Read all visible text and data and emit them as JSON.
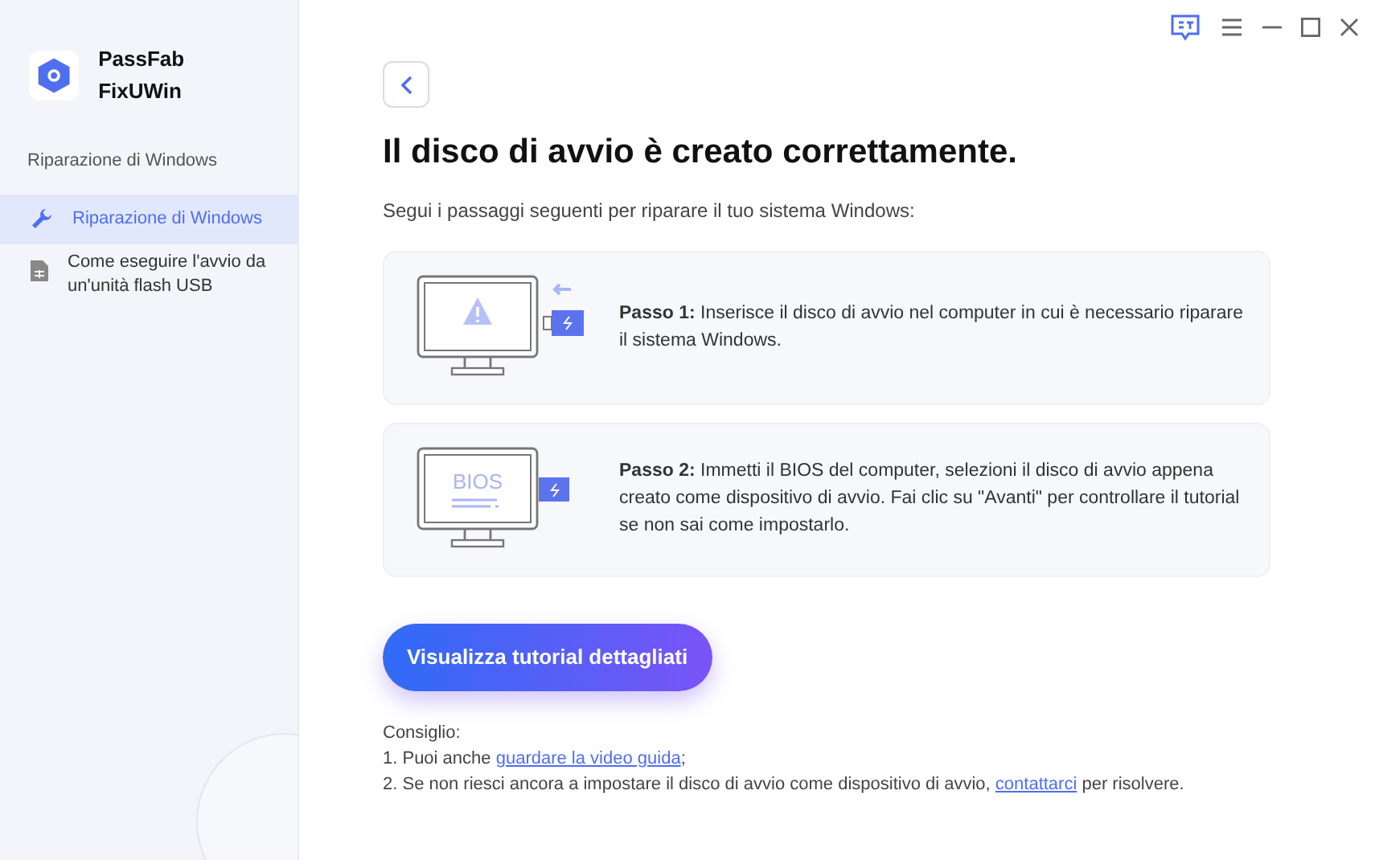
{
  "app": {
    "name": "PassFab FixUWin"
  },
  "sidebar": {
    "section_label": "Riparazione di Windows",
    "items": [
      {
        "label": "Riparazione di Windows",
        "selected": true,
        "kind": "wrench"
      },
      {
        "label": "Come eseguire l'avvio da un'unità flash USB",
        "selected": false,
        "kind": "file"
      }
    ]
  },
  "main": {
    "title": "Il disco di avvio è creato correttamente.",
    "subtitle": "Segui i passaggi seguenti per riparare il tuo sistema Windows:",
    "steps": [
      {
        "kind": "warning",
        "text": "**Passo 1:** Inserisce il disco di avvio nel computer in cui è necessario riparare il sistema Windows."
      },
      {
        "kind": "bios",
        "screen_text": "BIOS",
        "text": "**Passo 2:** Immetti il BIOS del computer, selezioni il disco di avvio appena creato come dispositivo di avvio. Fai clic su \"Avanti\" per controllare il tutorial se non sai come impostarlo."
      }
    ],
    "button": "Visualizza tutorial dettagliati",
    "tips": {
      "heading": "Consiglio:",
      "lines": [
        {
          "prefix": "1. Puoi anche ",
          "link": "guardare la video guida",
          "suffix": ";"
        },
        {
          "prefix": "2. Se non riesci ancora a impostare il disco di avvio come dispositivo di avvio, ",
          "link": "contattarci",
          "suffix": " per risolvere."
        }
      ]
    }
  }
}
